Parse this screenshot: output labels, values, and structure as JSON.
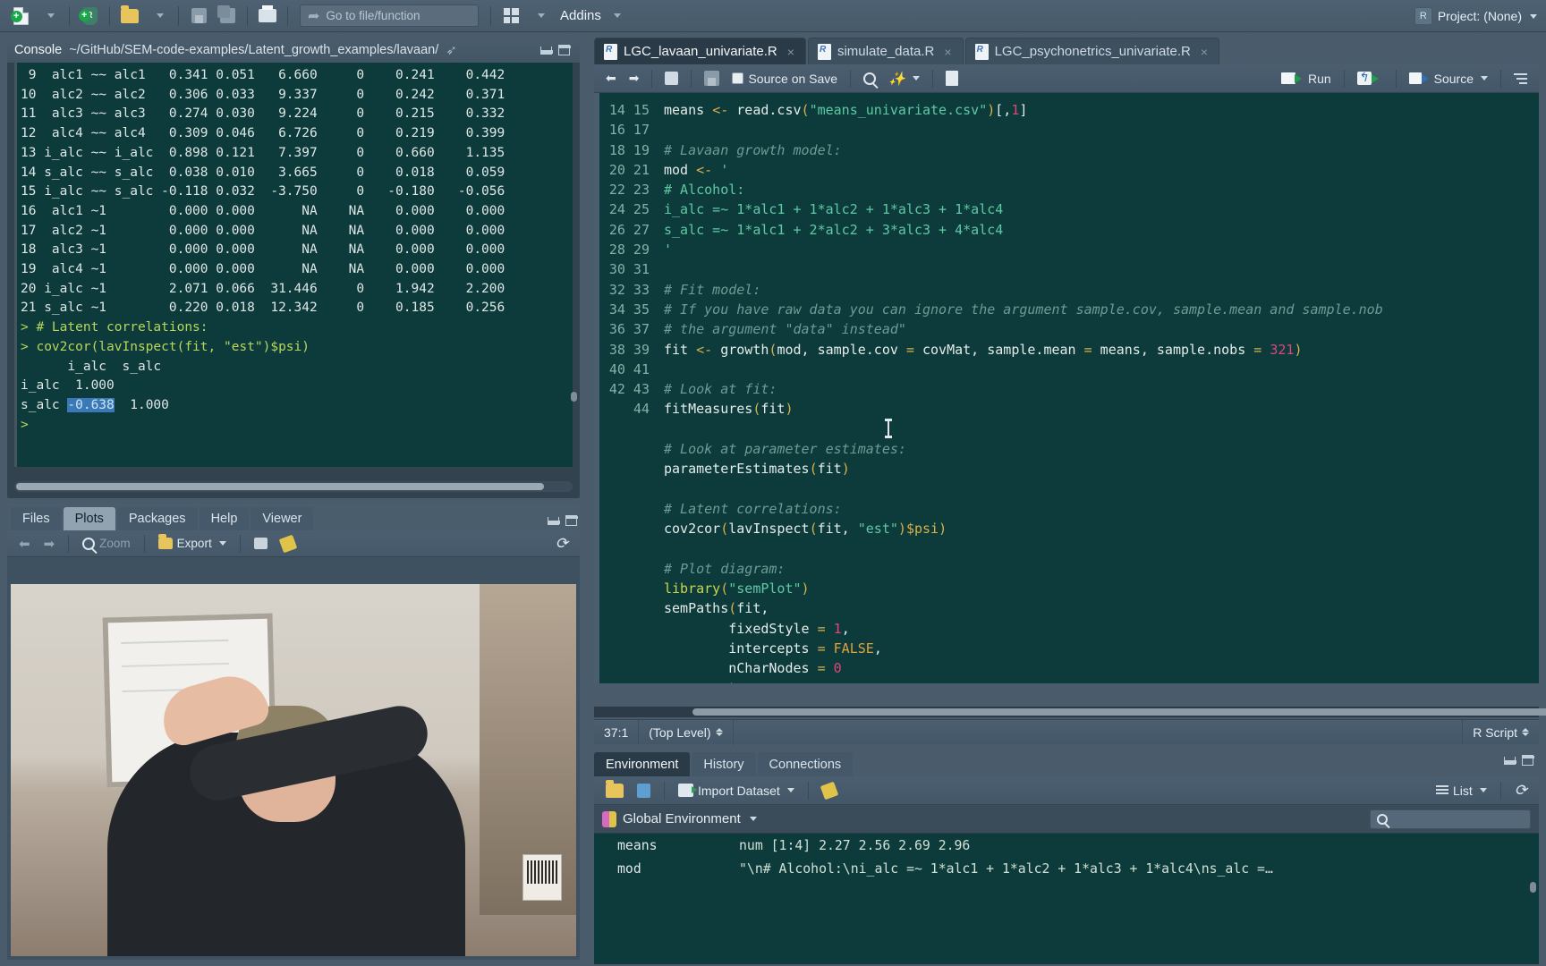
{
  "toolbar": {
    "new_file_label": "new-file",
    "new_project_label": "new-project",
    "open_label": "open-file",
    "save_label": "save",
    "save_all_label": "save-all",
    "print_label": "print",
    "goto_placeholder": "Go to file/function",
    "panes_label": "workspace-panes",
    "addins_label": "Addins",
    "project_label": "Project: (None)",
    "project_icon_text": "R"
  },
  "console": {
    "title": "Console",
    "path": "~/GitHub/SEM-code-examples/Latent_growth_examples/lavaan/",
    "rows": [
      {
        "num": "9",
        "a": "alc1",
        "op": "~~",
        "b": "alc1",
        "est": "0.341",
        "se": "0.051",
        "z": "6.660",
        "p": "0",
        "lo": "0.241",
        "hi": "0.442"
      },
      {
        "num": "10",
        "a": "alc2",
        "op": "~~",
        "b": "alc2",
        "est": "0.306",
        "se": "0.033",
        "z": "9.337",
        "p": "0",
        "lo": "0.242",
        "hi": "0.371"
      },
      {
        "num": "11",
        "a": "alc3",
        "op": "~~",
        "b": "alc3",
        "est": "0.274",
        "se": "0.030",
        "z": "9.224",
        "p": "0",
        "lo": "0.215",
        "hi": "0.332"
      },
      {
        "num": "12",
        "a": "alc4",
        "op": "~~",
        "b": "alc4",
        "est": "0.309",
        "se": "0.046",
        "z": "6.726",
        "p": "0",
        "lo": "0.219",
        "hi": "0.399"
      },
      {
        "num": "13",
        "a": "i_alc",
        "op": "~~",
        "b": "i_alc",
        "est": "0.898",
        "se": "0.121",
        "z": "7.397",
        "p": "0",
        "lo": "0.660",
        "hi": "1.135"
      },
      {
        "num": "14",
        "a": "s_alc",
        "op": "~~",
        "b": "s_alc",
        "est": "0.038",
        "se": "0.010",
        "z": "3.665",
        "p": "0",
        "lo": "0.018",
        "hi": "0.059"
      },
      {
        "num": "15",
        "a": "i_alc",
        "op": "~~",
        "b": "s_alc",
        "est": "-0.118",
        "se": "0.032",
        "z": "-3.750",
        "p": "0",
        "lo": "-0.180",
        "hi": "-0.056"
      },
      {
        "num": "16",
        "a": "alc1",
        "op": "~1",
        "b": "",
        "est": "0.000",
        "se": "0.000",
        "z": "NA",
        "p": "NA",
        "lo": "0.000",
        "hi": "0.000"
      },
      {
        "num": "17",
        "a": "alc2",
        "op": "~1",
        "b": "",
        "est": "0.000",
        "se": "0.000",
        "z": "NA",
        "p": "NA",
        "lo": "0.000",
        "hi": "0.000"
      },
      {
        "num": "18",
        "a": "alc3",
        "op": "~1",
        "b": "",
        "est": "0.000",
        "se": "0.000",
        "z": "NA",
        "p": "NA",
        "lo": "0.000",
        "hi": "0.000"
      },
      {
        "num": "19",
        "a": "alc4",
        "op": "~1",
        "b": "",
        "est": "0.000",
        "se": "0.000",
        "z": "NA",
        "p": "NA",
        "lo": "0.000",
        "hi": "0.000"
      },
      {
        "num": "20",
        "a": "i_alc",
        "op": "~1",
        "b": "",
        "est": "2.071",
        "se": "0.066",
        "z": "31.446",
        "p": "0",
        "lo": "1.942",
        "hi": "2.200"
      },
      {
        "num": "21",
        "a": "s_alc",
        "op": "~1",
        "b": "",
        "est": "0.220",
        "se": "0.018",
        "z": "12.342",
        "p": "0",
        "lo": "0.185",
        "hi": "0.256"
      }
    ],
    "cmd_comment": "> # Latent correlations:",
    "cmd_call": "> cov2cor(lavInspect(fit, \"est\")$psi)",
    "matrix_header": "      i_alc  s_alc",
    "matrix_row1": "i_alc  1.000",
    "matrix_row2_label": "s_alc ",
    "matrix_row2_selected": "-0.638",
    "matrix_row2_rest": "  1.000",
    "prompt": ">"
  },
  "plots": {
    "tabs": [
      "Files",
      "Plots",
      "Packages",
      "Help",
      "Viewer"
    ],
    "active_tab": "Plots",
    "toolbar": {
      "back_label": "back",
      "forward_label": "forward",
      "zoom_label": "Zoom",
      "export_label": "Export",
      "clear_label": "clear-plot",
      "remove_label": "remove-plot",
      "refresh_label": "refresh"
    }
  },
  "source": {
    "tabs": [
      {
        "label": "LGC_lavaan_univariate.R",
        "active": true
      },
      {
        "label": "simulate_data.R",
        "active": false
      },
      {
        "label": "LGC_psychonetrics_univariate.R",
        "active": false
      }
    ],
    "toolbar": {
      "back_label": "back",
      "forward_label": "forward",
      "show_doc_label": "show-in-new-window",
      "save_label": "save",
      "source_on_save_label": "Source on Save",
      "find_label": "find-replace",
      "compile_label": "compile-report",
      "outline_label": "document-outline",
      "run_label": "Run",
      "rerun_label": "re-run-previous",
      "source_button_label": "Source"
    },
    "lines": [
      {
        "n": "14",
        "html": "<span class=\"k-id\">means</span> <span class=\"k-op\">&lt;-</span> read.csv<span class=\"k-par\">(</span><span class=\"k-str\">\"means_univariate.csv\"</span><span class=\"k-par\">)</span>[,<span class=\"k-num\">1</span>]"
      },
      {
        "n": "15",
        "html": ""
      },
      {
        "n": "16",
        "html": "<span class=\"k-com\"># Lavaan growth model:</span>"
      },
      {
        "n": "17",
        "html": "<span class=\"k-id\">mod</span> <span class=\"k-op\">&lt;-</span> <span class=\"k-str\">'</span>"
      },
      {
        "n": "18",
        "html": "<span class=\"k-str\"># Alcohol:</span>"
      },
      {
        "n": "19",
        "html": "<span class=\"k-str\">i_alc =~ 1*alc1 + 1*alc2 + 1*alc3 + 1*alc4</span>"
      },
      {
        "n": "20",
        "html": "<span class=\"k-str\">s_alc =~ 1*alc1 + 2*alc2 + 3*alc3 + 4*alc4</span>"
      },
      {
        "n": "21",
        "html": "<span class=\"k-str\">'</span>"
      },
      {
        "n": "22",
        "html": ""
      },
      {
        "n": "23",
        "html": "<span class=\"k-com\"># Fit model:</span>"
      },
      {
        "n": "24",
        "html": "<span class=\"k-com\"># If you have raw data you can ignore the argument sample.cov, sample.mean and sample.nob</span>"
      },
      {
        "n": "25",
        "html": "<span class=\"k-com\"># the argument \"data\" instead\"</span>"
      },
      {
        "n": "26",
        "html": "<span class=\"k-id\">fit</span> <span class=\"k-op\">&lt;-</span> growth<span class=\"k-par\">(</span>mod, sample.cov <span class=\"k-op\">=</span> covMat, sample.mean <span class=\"k-op\">=</span> means, sample.nobs <span class=\"k-op\">=</span> <span class=\"k-num\">321</span><span class=\"k-par\">)</span>"
      },
      {
        "n": "27",
        "html": ""
      },
      {
        "n": "28",
        "html": "<span class=\"k-com\"># Look at fit:</span>"
      },
      {
        "n": "29",
        "html": "fitMeasures<span class=\"k-par\">(</span>fit<span class=\"k-par\">)</span>"
      },
      {
        "n": "30",
        "html": ""
      },
      {
        "n": "31",
        "html": "<span class=\"k-com\"># Look at parameter estimates:</span>"
      },
      {
        "n": "32",
        "html": "parameterEstimates<span class=\"k-par\">(</span>fit<span class=\"k-par\">)</span>"
      },
      {
        "n": "33",
        "html": ""
      },
      {
        "n": "34",
        "html": "<span class=\"k-com\"># Latent correlations:</span>"
      },
      {
        "n": "35",
        "html": "cov2cor<span class=\"k-par\">(</span>lavInspect<span class=\"k-par\">(</span>fit, <span class=\"k-str\">\"est\"</span><span class=\"k-par\">)</span><span class=\"k-op\">$psi</span><span class=\"k-par\">)</span>"
      },
      {
        "n": "36",
        "html": ""
      },
      {
        "n": "37",
        "html": "<span class=\"k-com\"># Plot diagram:</span>"
      },
      {
        "n": "38",
        "html": "<span class=\"k-lib\">library</span><span class=\"k-par\">(</span><span class=\"k-str\">\"semPlot\"</span><span class=\"k-par\">)</span>"
      },
      {
        "n": "39",
        "html": "semPaths<span class=\"k-par\">(</span>fit,"
      },
      {
        "n": "40",
        "html": "        fixedStyle <span class=\"k-op\">=</span> <span class=\"k-num\">1</span>,"
      },
      {
        "n": "41",
        "html": "        intercepts <span class=\"k-op\">=</span> <span class=\"k-const\">FALSE</span>,"
      },
      {
        "n": "42",
        "html": "        nCharNodes <span class=\"k-op\">=</span> <span class=\"k-num\">0</span>"
      },
      {
        "n": "43",
        "html": "        <span class=\"k-par\">)</span>"
      },
      {
        "n": "44",
        "html": ""
      }
    ],
    "status": {
      "cursor_position": "37:1",
      "scope": "(Top Level)",
      "file_type": "R Script"
    }
  },
  "environment": {
    "tabs": [
      "Environment",
      "History",
      "Connections"
    ],
    "active_tab": "Environment",
    "toolbar": {
      "load_label": "load-workspace",
      "save_label": "save-workspace",
      "import_dataset_label": "Import Dataset",
      "clear_label": "clear-objects",
      "view_mode_label": "List",
      "refresh_label": "refresh"
    },
    "scope_label": "Global Environment",
    "search_placeholder": "",
    "objects": [
      {
        "name": "means",
        "value": "num [1:4] 2.27 2.56 2.69 2.96"
      },
      {
        "name": "mod",
        "value": "\"\\n# Alcohol:\\ni_alc =~ 1*alc1 + 1*alc2 + 1*alc3 + 1*alc4\\ns_alc =…"
      }
    ]
  },
  "colors": {
    "editor_bg": "#0d3b3b",
    "chrome": "#4a5b6b",
    "accent_green": "#b8d65c",
    "selection": "#3a79b8"
  }
}
